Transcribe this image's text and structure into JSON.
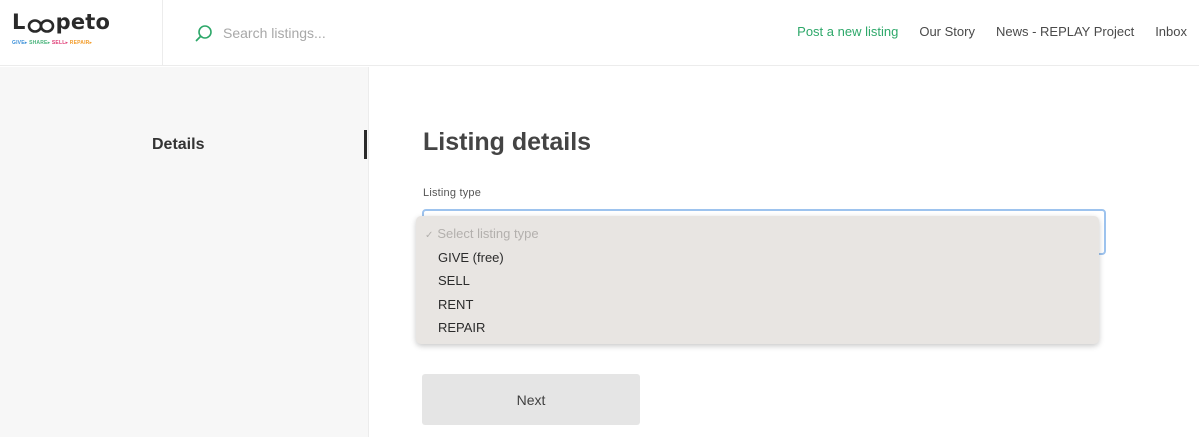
{
  "header": {
    "logo": {
      "text_before": "L",
      "text_after": "peto",
      "tag_give": "GIVE▸",
      "tag_share": "SHARE▸",
      "tag_sell": "SELL▸",
      "tag_repair": "REPAIR▸"
    },
    "search": {
      "placeholder": "Search listings...",
      "value": "",
      "icon": "search-icon",
      "icon_color": "#2ea86a"
    },
    "nav": [
      {
        "label": "Post a new listing",
        "color": "#2ea86a"
      },
      {
        "label": "Our Story"
      },
      {
        "label": "News - REPLAY Project"
      },
      {
        "label": "Inbox"
      }
    ]
  },
  "sidebar": {
    "tabs": [
      {
        "label": "Details",
        "active": true
      }
    ]
  },
  "main": {
    "title": "Listing details",
    "listing_type": {
      "label": "Listing type",
      "selected": "Select listing type",
      "options": [
        "Select listing type",
        "GIVE (free)",
        "SELL",
        "RENT",
        "REPAIR"
      ],
      "check_icon": "check-icon"
    },
    "next_label": "Next"
  }
}
